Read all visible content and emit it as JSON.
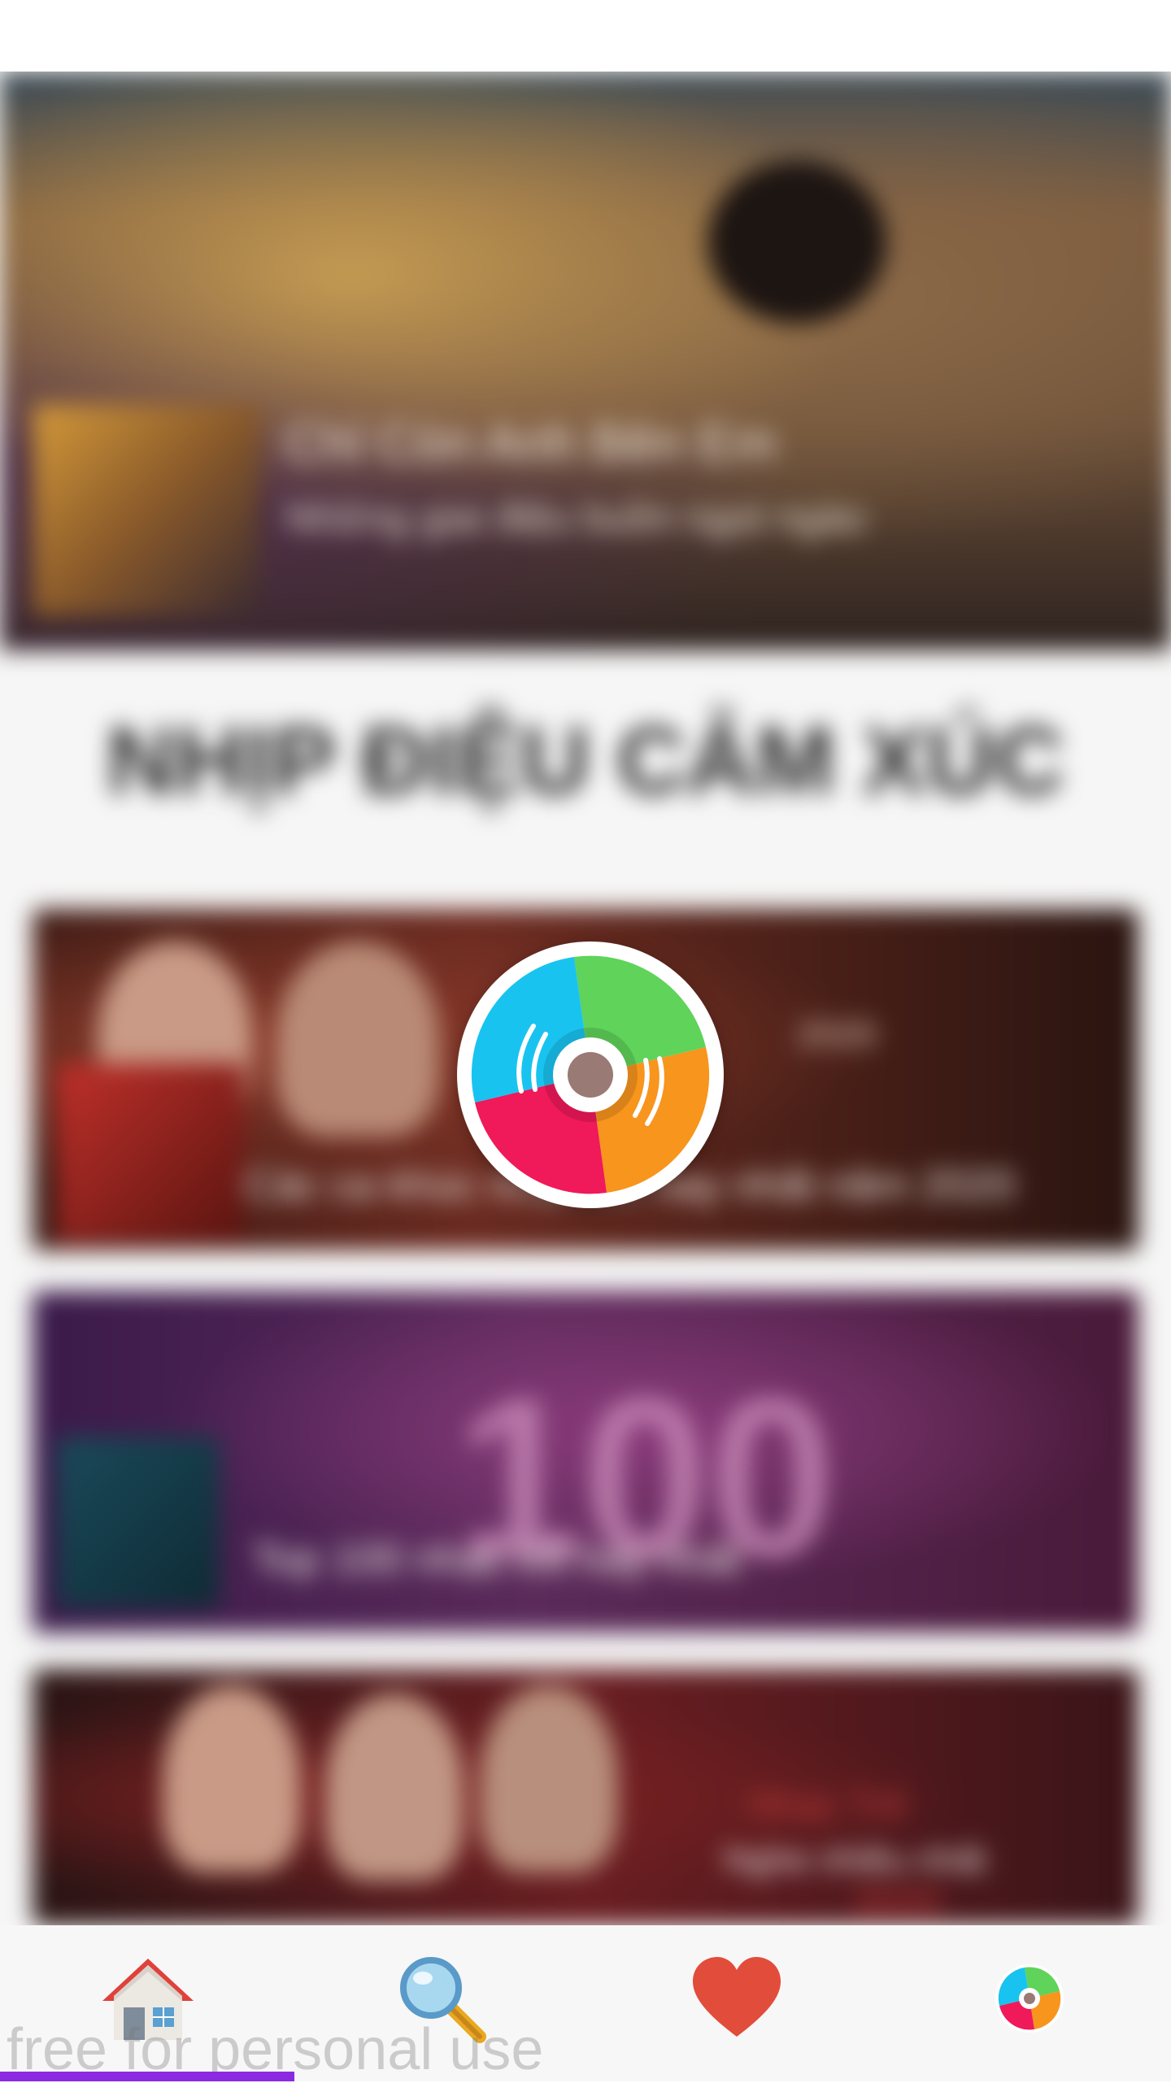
{
  "hero": {
    "title": "Chỉ Còn Anh Bên Em",
    "subtitle": "Những giai điệu buồn ngọt ngào"
  },
  "section": {
    "heading": "NHỊP ĐIỆU CẢM XÚC"
  },
  "cards": [
    {
      "caption": "Các ca khúc nhạc trẻ hay nhất năm 2020",
      "tag": "2020"
    },
    {
      "big_text": "100",
      "caption": "Top 100 nhạc trẻ hay nhất"
    },
    {
      "red_text": "Nhạc Trẻ",
      "white_text": "Nghe nhiều nhất",
      "year": "2020"
    }
  ],
  "loader": {
    "icon": "disc-loading-icon",
    "colors": [
      "#19c3f0",
      "#5fd35a",
      "#f7951d",
      "#f0195a"
    ]
  },
  "bottom_nav": {
    "items": [
      {
        "name": "home",
        "icon": "home-icon",
        "active": true
      },
      {
        "name": "search",
        "icon": "search-icon",
        "active": false
      },
      {
        "name": "favorites",
        "icon": "heart-icon",
        "active": false
      },
      {
        "name": "app",
        "icon": "disc-app-icon",
        "active": false
      }
    ],
    "accent": "#8a2be2"
  },
  "watermark": "free for personal use"
}
